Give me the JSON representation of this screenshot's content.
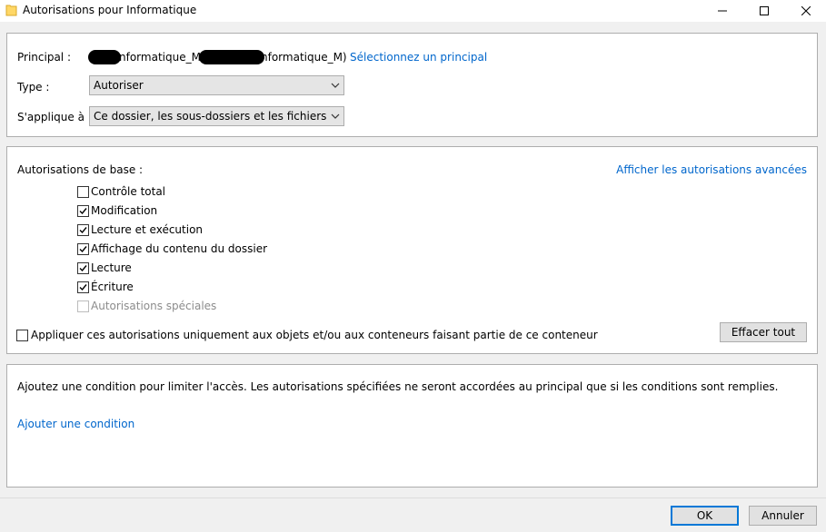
{
  "window": {
    "title": "Autorisations pour Informatique",
    "icon": "folder-icon",
    "controls": [
      "minimize-icon",
      "maximize-icon",
      "close-icon"
    ]
  },
  "principal": {
    "label": "Principal :",
    "name_visible": "nformatique_M (",
    "name_visible_2": "nformatique_M)",
    "select_link": "Sélectionnez un principal"
  },
  "type": {
    "label": "Type :",
    "value": "Autoriser"
  },
  "applies_to": {
    "label": "S'applique à :",
    "value": "Ce dossier, les sous-dossiers et les fichiers"
  },
  "basic_permissions": {
    "heading": "Autorisations de base :",
    "advanced_link": "Afficher les autorisations avancées",
    "items": [
      {
        "label": "Contrôle total",
        "checked": false,
        "disabled": false
      },
      {
        "label": "Modification",
        "checked": true,
        "disabled": false
      },
      {
        "label": "Lecture et exécution",
        "checked": true,
        "disabled": false
      },
      {
        "label": "Affichage du contenu du dossier",
        "checked": true,
        "disabled": false
      },
      {
        "label": "Lecture",
        "checked": true,
        "disabled": false
      },
      {
        "label": "Écriture",
        "checked": true,
        "disabled": false
      },
      {
        "label": "Autorisations spéciales",
        "checked": false,
        "disabled": true
      }
    ],
    "apply_only_label": "Appliquer ces autorisations uniquement aux objets et/ou aux conteneurs faisant partie de ce conteneur",
    "apply_only_checked": false,
    "clear_all": "Effacer tout"
  },
  "condition": {
    "description": "Ajoutez une condition pour limiter l'accès. Les autorisations spécifiées ne seront accordées au principal que si les conditions sont remplies.",
    "add_link": "Ajouter une condition"
  },
  "footer": {
    "ok": "OK",
    "cancel": "Annuler"
  },
  "colors": {
    "link": "#0066cc",
    "accent": "#0078d7",
    "background": "#f0f0f0",
    "panel": "#ffffff"
  }
}
